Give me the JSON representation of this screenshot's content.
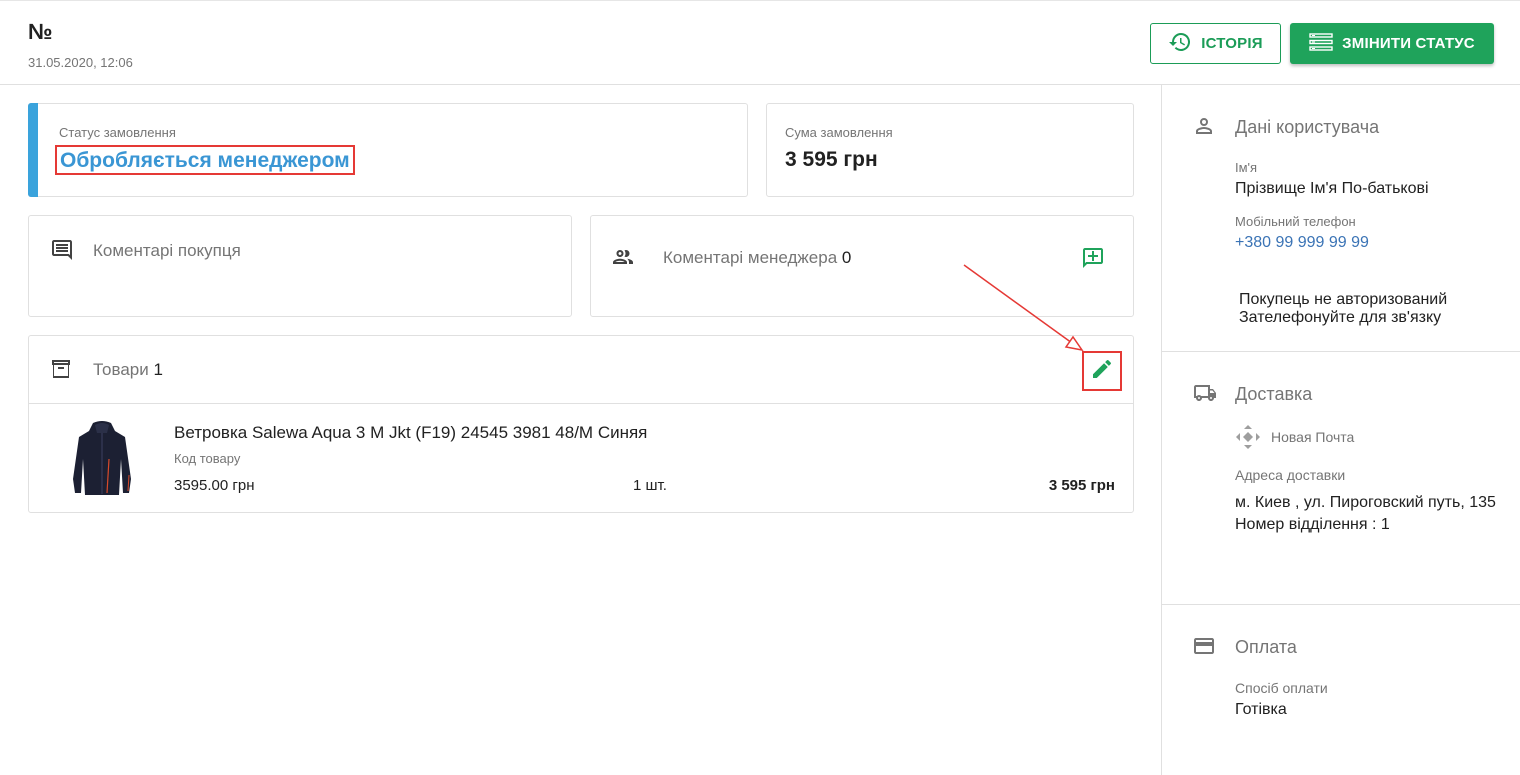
{
  "header": {
    "order_number": "№",
    "order_date": "31.05.2020, 12:06",
    "history_label": "ІСТОРІЯ",
    "change_status_label": "ЗМІНИТИ СТАТУС"
  },
  "status_card": {
    "label": "Статус замовлення",
    "value": "Обробляється менеджером",
    "accent_color": "#3aa3dc"
  },
  "sum_card": {
    "label": "Сума замовлення",
    "value": "3 595 грн"
  },
  "buyer_comments": {
    "title": "Коментарі покупця"
  },
  "manager_comments": {
    "title": "Коментарі менеджера",
    "count": "0"
  },
  "goods": {
    "title": "Товари",
    "count": "1",
    "items": [
      {
        "name": "Ветровка Salewa Aqua 3 M Jkt (F19) 24545 3981 48/M Синяя",
        "code_label": "Код товару",
        "price": "3595.00 грн",
        "qty": "1 шт.",
        "total": "3 595 грн"
      }
    ]
  },
  "sidebar": {
    "user": {
      "title": "Дані користувача",
      "name_label": "Ім'я",
      "name_value": "Прізвище Ім'я По-батькові",
      "phone_label": "Мобільний телефон",
      "phone_value": "+380 99 999 99 99",
      "note_line1": "Покупець не авторизований",
      "note_line2": "Зателефонуйте для зв'язку"
    },
    "delivery": {
      "title": "Доставка",
      "carrier": "Новая Почта",
      "address_label": "Адреса доставки",
      "address_line1": "м. Киев , ул. Пироговский путь, 135",
      "address_line2": "Номер відділення : 1"
    },
    "payment": {
      "title": "Оплата",
      "method_label": "Спосіб оплати",
      "method_value": "Готівка"
    }
  },
  "colors": {
    "primary_green": "#1fa35b",
    "status_blue": "#3a96d4",
    "annotation_red": "#e53935"
  }
}
